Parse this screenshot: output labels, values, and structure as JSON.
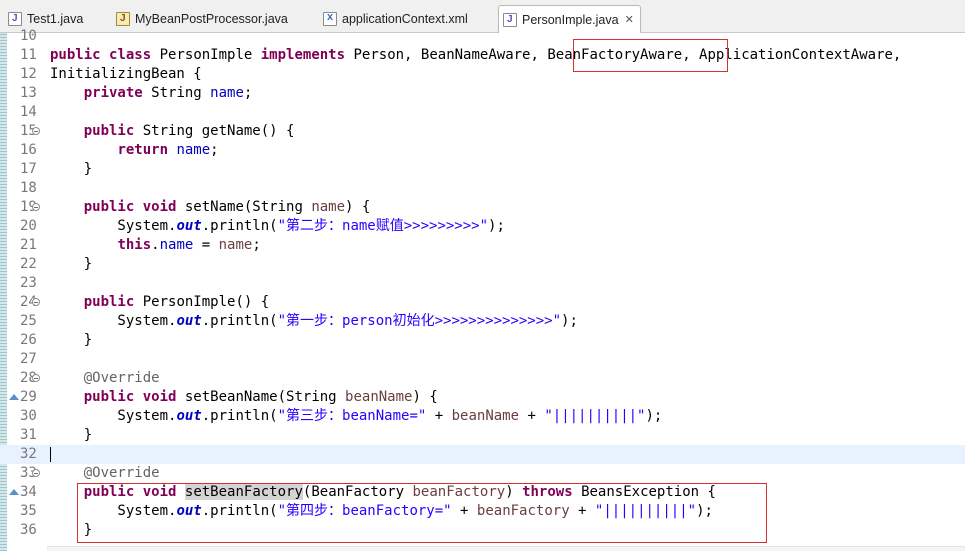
{
  "tabs": [
    {
      "label": "Test1.java",
      "icon": "java-file-icon"
    },
    {
      "label": "MyBeanPostProcessor.java",
      "icon": "java-bean-file-icon"
    },
    {
      "label": "applicationContext.xml",
      "icon": "xml-file-icon"
    },
    {
      "label": "PersonImple.java",
      "icon": "java-file-icon",
      "active": true,
      "close": "✕"
    }
  ],
  "editor": {
    "lines": [
      {
        "n": "10"
      },
      {
        "n": "11",
        "tokens": [
          {
            "c": "kw",
            "t": "public"
          },
          {
            "t": " "
          },
          {
            "c": "kw",
            "t": "class"
          },
          {
            "t": " PersonImple "
          },
          {
            "c": "kw",
            "t": "implements"
          },
          {
            "t": " Person, BeanNameAware, "
          },
          {
            "t": "BeanFactoryAware"
          },
          {
            "t": ", ApplicationContextAware,"
          }
        ]
      },
      {
        "n": "12",
        "tokens": [
          {
            "t": "InitializingBean {"
          }
        ]
      },
      {
        "n": "13",
        "tokens": [
          {
            "t": "    "
          },
          {
            "c": "kw",
            "t": "private"
          },
          {
            "t": " String "
          },
          {
            "c": "fld",
            "t": "name"
          },
          {
            "t": ";"
          }
        ]
      },
      {
        "n": "14"
      },
      {
        "n": "15",
        "fold": true,
        "tokens": [
          {
            "t": "    "
          },
          {
            "c": "kw",
            "t": "public"
          },
          {
            "t": " String getName() {"
          }
        ]
      },
      {
        "n": "16",
        "tokens": [
          {
            "t": "        "
          },
          {
            "c": "kw",
            "t": "return"
          },
          {
            "t": " "
          },
          {
            "c": "fld",
            "t": "name"
          },
          {
            "t": ";"
          }
        ]
      },
      {
        "n": "17",
        "tokens": [
          {
            "t": "    }"
          }
        ]
      },
      {
        "n": "18"
      },
      {
        "n": "19",
        "fold": true,
        "tokens": [
          {
            "t": "    "
          },
          {
            "c": "kw",
            "t": "public"
          },
          {
            "t": " "
          },
          {
            "c": "kw",
            "t": "void"
          },
          {
            "t": " setName(String "
          },
          {
            "c": "prm",
            "t": "name"
          },
          {
            "t": ") {"
          }
        ]
      },
      {
        "n": "20",
        "tokens": [
          {
            "t": "        System."
          },
          {
            "c": "sfld",
            "t": "out"
          },
          {
            "t": ".println("
          },
          {
            "c": "str",
            "t": "\"第二步：name赋值>>>>>>>>>\""
          },
          {
            "t": ");"
          }
        ]
      },
      {
        "n": "21",
        "tokens": [
          {
            "t": "        "
          },
          {
            "c": "kw",
            "t": "this"
          },
          {
            "t": "."
          },
          {
            "c": "fld",
            "t": "name"
          },
          {
            "t": " = "
          },
          {
            "c": "prm",
            "t": "name"
          },
          {
            "t": ";"
          }
        ]
      },
      {
        "n": "22",
        "tokens": [
          {
            "t": "    }"
          }
        ]
      },
      {
        "n": "23"
      },
      {
        "n": "24",
        "fold": true,
        "tokens": [
          {
            "t": "    "
          },
          {
            "c": "kw",
            "t": "public"
          },
          {
            "t": " PersonImple() {"
          }
        ]
      },
      {
        "n": "25",
        "tokens": [
          {
            "t": "        System."
          },
          {
            "c": "sfld",
            "t": "out"
          },
          {
            "t": ".println("
          },
          {
            "c": "str",
            "t": "\"第一步：person初始化>>>>>>>>>>>>>>\""
          },
          {
            "t": ");"
          }
        ]
      },
      {
        "n": "26",
        "tokens": [
          {
            "t": "    }"
          }
        ]
      },
      {
        "n": "27"
      },
      {
        "n": "28",
        "fold": true,
        "tokens": [
          {
            "t": "    "
          },
          {
            "c": "ann",
            "t": "@Override"
          }
        ]
      },
      {
        "n": "29",
        "override": true,
        "tokens": [
          {
            "t": "    "
          },
          {
            "c": "kw",
            "t": "public"
          },
          {
            "t": " "
          },
          {
            "c": "kw",
            "t": "void"
          },
          {
            "t": " setBeanName(String "
          },
          {
            "c": "prm",
            "t": "beanName"
          },
          {
            "t": ") {"
          }
        ]
      },
      {
        "n": "30",
        "tokens": [
          {
            "t": "        System."
          },
          {
            "c": "sfld",
            "t": "out"
          },
          {
            "t": ".println("
          },
          {
            "c": "str",
            "t": "\"第三步：beanName=\""
          },
          {
            "t": " + "
          },
          {
            "c": "prm",
            "t": "beanName"
          },
          {
            "t": " + "
          },
          {
            "c": "str",
            "t": "\"||||||||||\""
          },
          {
            "t": ");"
          }
        ]
      },
      {
        "n": "31",
        "tokens": [
          {
            "t": "    }"
          }
        ]
      },
      {
        "n": "32",
        "current": true
      },
      {
        "n": "33",
        "fold": true,
        "tokens": [
          {
            "t": "    "
          },
          {
            "c": "ann",
            "t": "@Override"
          }
        ]
      },
      {
        "n": "34",
        "override": true,
        "tokens": [
          {
            "t": "    "
          },
          {
            "c": "kw",
            "t": "public"
          },
          {
            "t": " "
          },
          {
            "c": "kw",
            "t": "void"
          },
          {
            "t": " "
          },
          {
            "c": "occ",
            "t": "setBeanFactory"
          },
          {
            "t": "(BeanFactory "
          },
          {
            "c": "prm",
            "t": "beanFactory"
          },
          {
            "t": ") "
          },
          {
            "c": "kw",
            "t": "throws"
          },
          {
            "t": " BeansException {"
          }
        ]
      },
      {
        "n": "35",
        "tokens": [
          {
            "t": "        System."
          },
          {
            "c": "sfld",
            "t": "out"
          },
          {
            "t": ".println("
          },
          {
            "c": "str",
            "t": "\"第四步：beanFactory=\""
          },
          {
            "t": " + "
          },
          {
            "c": "prm",
            "t": "beanFactory"
          },
          {
            "t": " + "
          },
          {
            "c": "str",
            "t": "\"||||||||||\""
          },
          {
            "t": ");"
          }
        ]
      },
      {
        "n": "36",
        "tokens": [
          {
            "t": "    }"
          }
        ]
      }
    ]
  },
  "colors": {
    "keyword": "#7f0055",
    "field": "#0000c0",
    "string": "#2a00ff",
    "annotation": "#646464",
    "highlight_box": "#d9302a",
    "current_line": "#e8f2fe"
  }
}
